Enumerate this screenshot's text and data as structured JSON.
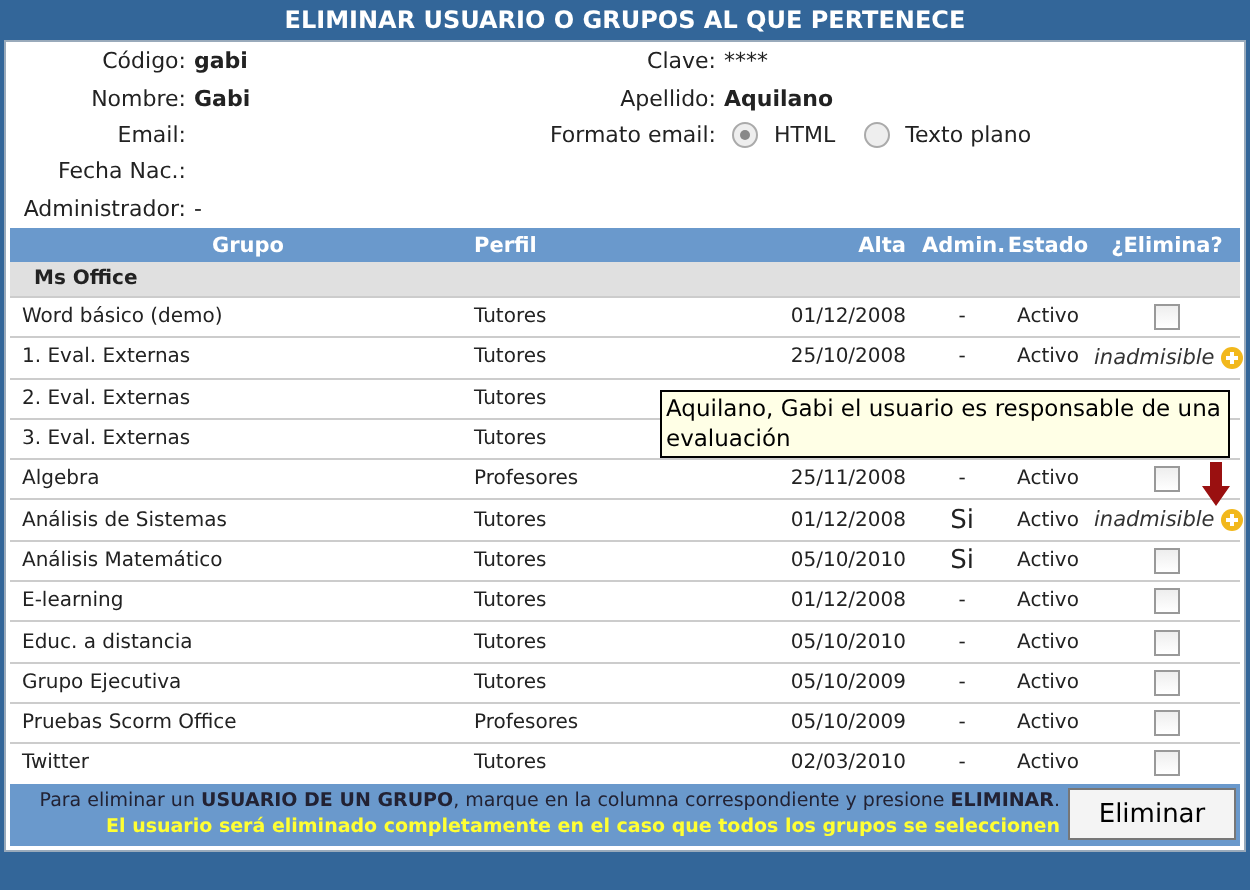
{
  "title": "ELIMINAR USUARIO O GRUPOS AL QUE PERTENECE",
  "info_left": [
    {
      "label": "Código:",
      "value": "gabi"
    },
    {
      "label": "Nombre:",
      "value": "Gabi"
    },
    {
      "label": "Email:"
    },
    {
      "label": "Fecha Nac.:"
    }
  ],
  "administrador": {
    "label": "Administrador:",
    "value": "-"
  },
  "info_right": {
    "clave_label": "Clave:",
    "clave_value": "****",
    "apellido_label": "Apellido:",
    "apellido_value": "Aquilano",
    "formato_label": "Formato email:",
    "formats": [
      {
        "label": "HTML",
        "selected": true
      },
      {
        "label": "Texto plano",
        "selected": false
      }
    ]
  },
  "table": {
    "columns": [
      "Grupo",
      "Perfil",
      "Alta",
      "Admin.",
      "Estado",
      "¿Elimina?"
    ],
    "section": "Ms Office",
    "rows": [
      {
        "grupo": "Word básico (demo)",
        "perfil": "Tutores",
        "alta": "01/12/2008",
        "admin": "-",
        "estado": "Activo",
        "kind": "checkbox",
        "checked": false
      },
      {
        "grupo": "1. Eval. Externas",
        "perfil": "Tutores",
        "alta": "25/10/2008",
        "admin": "-",
        "estado": "Activo",
        "kind": "blocked",
        "label": "inadmisible"
      },
      {
        "grupo": "2. Eval. Externas",
        "perfil": "Tutores",
        "kind": "hidden"
      },
      {
        "grupo": "3. Eval. Externas",
        "perfil": "Tutores",
        "kind": "hidden"
      },
      {
        "grupo": "Algebra",
        "perfil": "Profesores",
        "alta": "25/11/2008",
        "admin": "-",
        "estado": "Activo",
        "kind": "checkbox",
        "checked": false
      },
      {
        "grupo": "Análisis de Sistemas",
        "perfil": "Tutores",
        "alta": "01/12/2008",
        "admin": "Si",
        "estado": "Activo",
        "kind": "blocked",
        "label": "inadmisible"
      },
      {
        "grupo": "Análisis Matemático",
        "perfil": "Tutores",
        "alta": "05/10/2010",
        "admin": "Si",
        "estado": "Activo",
        "kind": "checkbox",
        "checked": false
      },
      {
        "grupo": "E-learning",
        "perfil": "Tutores",
        "alta": "01/12/2008",
        "admin": "-",
        "estado": "Activo",
        "kind": "checkbox",
        "checked": false
      },
      {
        "grupo": "Educ. a distancia",
        "perfil": "Tutores",
        "alta": "05/10/2010",
        "admin": "-",
        "estado": "Activo",
        "kind": "checkbox",
        "checked": false
      },
      {
        "grupo": "Grupo Ejecutiva",
        "perfil": "Tutores",
        "alta": "05/10/2009",
        "admin": "-",
        "estado": "Activo",
        "kind": "checkbox",
        "checked": false
      },
      {
        "grupo": "Pruebas Scorm Office",
        "perfil": "Profesores",
        "alta": "05/10/2009",
        "admin": "-",
        "estado": "Activo",
        "kind": "checkbox",
        "checked": false
      },
      {
        "grupo": "Twitter",
        "perfil": "Tutores",
        "alta": "02/03/2010",
        "admin": "-",
        "estado": "Activo",
        "kind": "checkbox",
        "checked": false
      }
    ]
  },
  "tooltip": "Aquilano, Gabi el usuario es responsable de una evaluación",
  "footer": {
    "instruction": "Para eliminar un **USUARIO DE UN GRUPO**, marque en la columna correspondiente y presione **ELIMINAR**.",
    "warning": "El usuario será eliminado completamente en el caso que todos los grupos se seleccionen",
    "button": "Eliminar"
  }
}
